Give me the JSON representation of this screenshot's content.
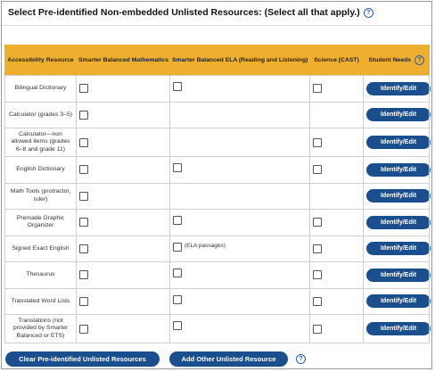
{
  "section_title": "Select Pre-identified Non-embedded Unlisted Resources: (Select all that apply.)",
  "columns": {
    "resource": "Accessibility Resource",
    "math": "Smarter Balanced Mathematics",
    "ela": "Smarter Balanced ELA (Reading and Listening)",
    "science": "Science (CAST)",
    "needs": "Student Needs"
  },
  "rows": [
    {
      "name": "Bilingual Dictionary",
      "math": true,
      "ela": true,
      "ela_note": "",
      "science": true
    },
    {
      "name": "Calculator (grades 3–5)",
      "math": true,
      "ela": false,
      "ela_note": "",
      "science": false
    },
    {
      "name": "Calculator—non allowed items (grades 6–8 and grade 11)",
      "math": true,
      "ela": false,
      "ela_note": "",
      "science": true
    },
    {
      "name": "English Dictionary",
      "math": true,
      "ela": true,
      "ela_note": "",
      "science": true
    },
    {
      "name": "Math Tools (protractor, ruler)",
      "math": true,
      "ela": false,
      "ela_note": "",
      "science": false
    },
    {
      "name": "Premade Graphic Organizer",
      "math": true,
      "ela": true,
      "ela_note": "",
      "science": true
    },
    {
      "name": "Signed Exact English",
      "math": true,
      "ela": true,
      "ela_note": "(ELA passages)",
      "science": true
    },
    {
      "name": "Thesaurus",
      "math": true,
      "ela": true,
      "ela_note": "",
      "science": true
    },
    {
      "name": "Translated Word Lists",
      "math": true,
      "ela": true,
      "ela_note": "",
      "science": true
    },
    {
      "name": "Translations (not provided by Smarter Balanced or ETS)",
      "math": true,
      "ela": true,
      "ela_note": "",
      "science": true
    }
  ],
  "identify_label": "Identify/Edit",
  "footer": {
    "clear_label": "Clear Pre-identified Unlisted Resources",
    "add_label": "Add Other Unlisted Resource"
  },
  "icons": {
    "help": "question-circle-icon"
  },
  "colors": {
    "header": "#efaf2e",
    "button": "#1b4e8c",
    "help": "#2a5db0"
  }
}
